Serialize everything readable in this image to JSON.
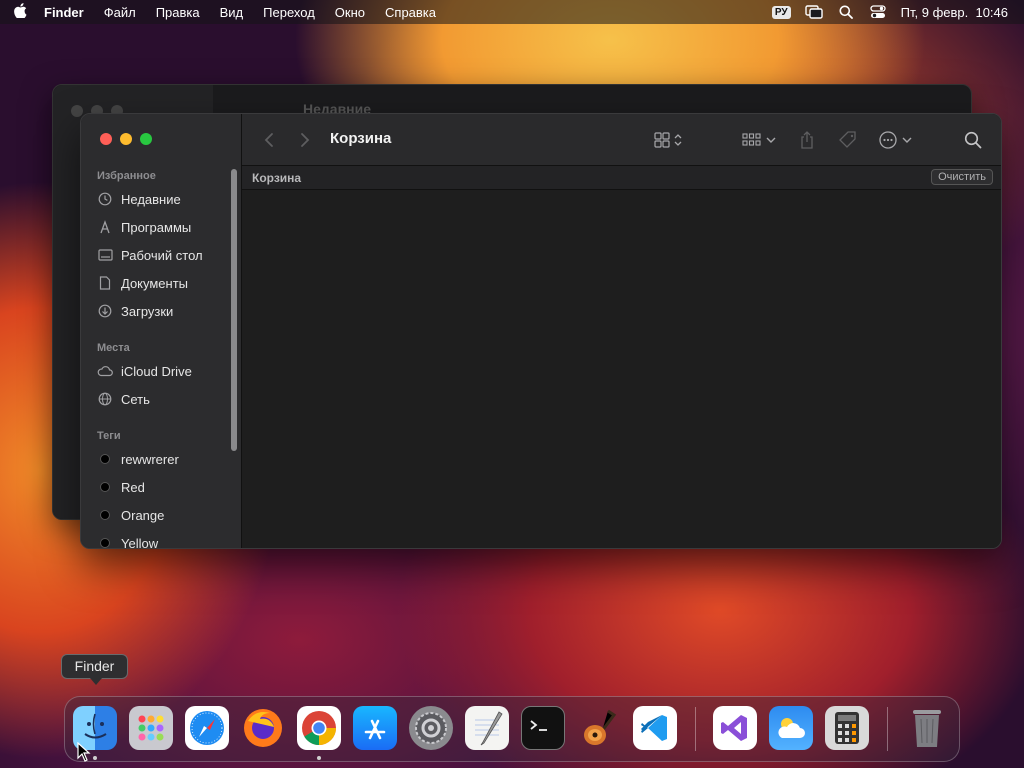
{
  "menubar": {
    "app": "Finder",
    "items": [
      "Файл",
      "Правка",
      "Вид",
      "Переход",
      "Окно",
      "Справка"
    ],
    "keyboard": "РУ",
    "datetime": "Пт, 9 февр.  10:46"
  },
  "bg_window": {
    "title": "Недавние"
  },
  "finder": {
    "title": "Корзина",
    "path_title": "Корзина",
    "clear_label": "Очистить",
    "sidebar": {
      "favorites_title": "Избранное",
      "favorites": [
        {
          "label": "Недавние",
          "icon": "clock-icon"
        },
        {
          "label": "Программы",
          "icon": "apps-icon"
        },
        {
          "label": "Рабочий стол",
          "icon": "desktop-icon"
        },
        {
          "label": "Документы",
          "icon": "document-icon"
        },
        {
          "label": "Загрузки",
          "icon": "download-icon"
        }
      ],
      "places_title": "Места",
      "places": [
        {
          "label": "iCloud Drive",
          "icon": "cloud-icon"
        },
        {
          "label": "Сеть",
          "icon": "network-icon"
        }
      ],
      "tags_title": "Теги",
      "tags": [
        {
          "label": "rewwrerer"
        },
        {
          "label": "Red"
        },
        {
          "label": "Orange"
        },
        {
          "label": "Yellow"
        }
      ]
    }
  },
  "dock": {
    "tooltip": "Finder",
    "apps": [
      "finder",
      "launchpad",
      "safari",
      "firefox",
      "chrome",
      "app-store",
      "system-preferences",
      "textedit",
      "terminal",
      "garageband",
      "vscode",
      "visual-studio",
      "weather",
      "calculator",
      "trash"
    ]
  },
  "colors": {
    "traffic_red": "#ff5f57",
    "traffic_yellow": "#febc2e",
    "traffic_green": "#28c840"
  }
}
